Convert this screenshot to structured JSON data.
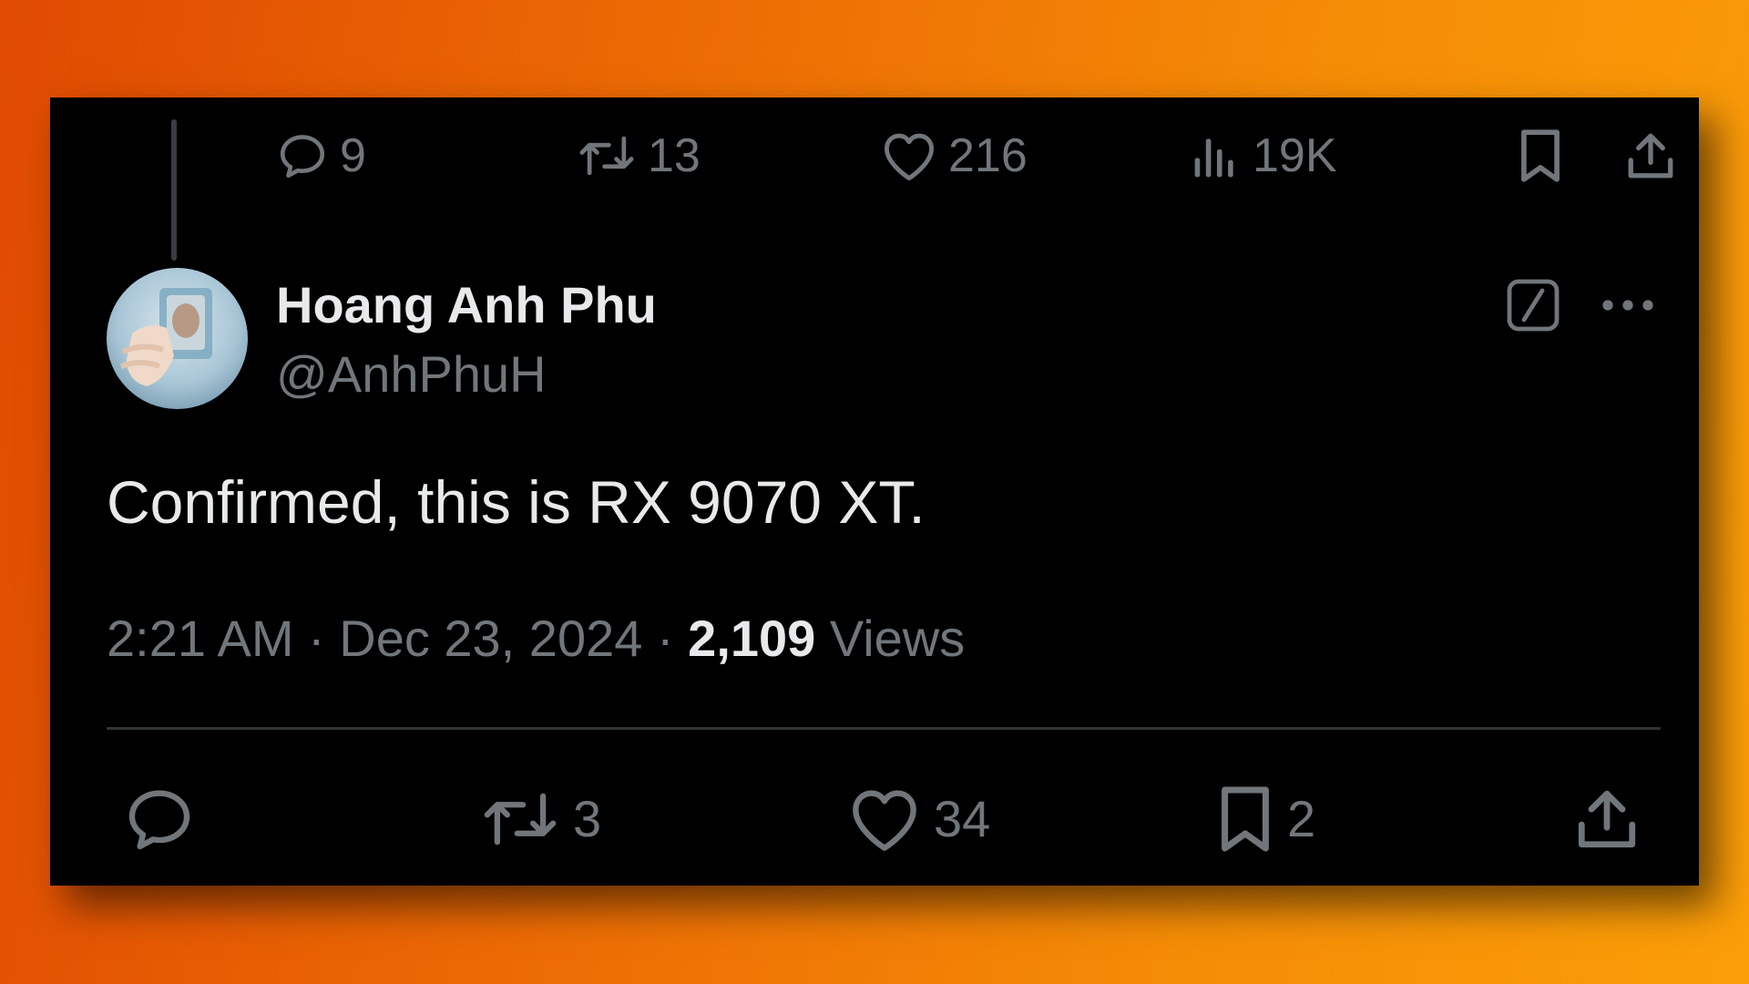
{
  "colors": {
    "background_start": "#e04a02",
    "background_end": "#fb9e08",
    "card": "#000000",
    "primary_text": "#e7e9ea",
    "secondary_text": "#71767b",
    "divider": "#2f3336"
  },
  "parent_tweet_actions": {
    "replies": {
      "icon": "reply-icon",
      "count": "9"
    },
    "reposts": {
      "icon": "repost-icon",
      "count": "13"
    },
    "likes": {
      "icon": "heart-icon",
      "count": "216"
    },
    "views": {
      "icon": "analytics-icon",
      "count": "19K"
    },
    "bookmark": {
      "icon": "bookmark-icon"
    },
    "share": {
      "icon": "share-icon"
    }
  },
  "tweet": {
    "author_name": "Hoang Anh Phu",
    "author_handle": "@AnhPhuH",
    "text": "Confirmed, this is RX 9070 XT.",
    "time": "2:21 AM",
    "separator": "·",
    "date": "Dec 23, 2024",
    "views_count": "2,109",
    "views_label": "Views",
    "grok_icon": "grok-icon",
    "more_icon": "more-icon"
  },
  "tweet_actions": {
    "reply": {
      "icon": "reply-icon"
    },
    "reposts": {
      "icon": "repost-icon",
      "count": "3"
    },
    "likes": {
      "icon": "heart-icon",
      "count": "34"
    },
    "bookmarks": {
      "icon": "bookmark-icon",
      "count": "2"
    },
    "share": {
      "icon": "share-icon"
    }
  }
}
